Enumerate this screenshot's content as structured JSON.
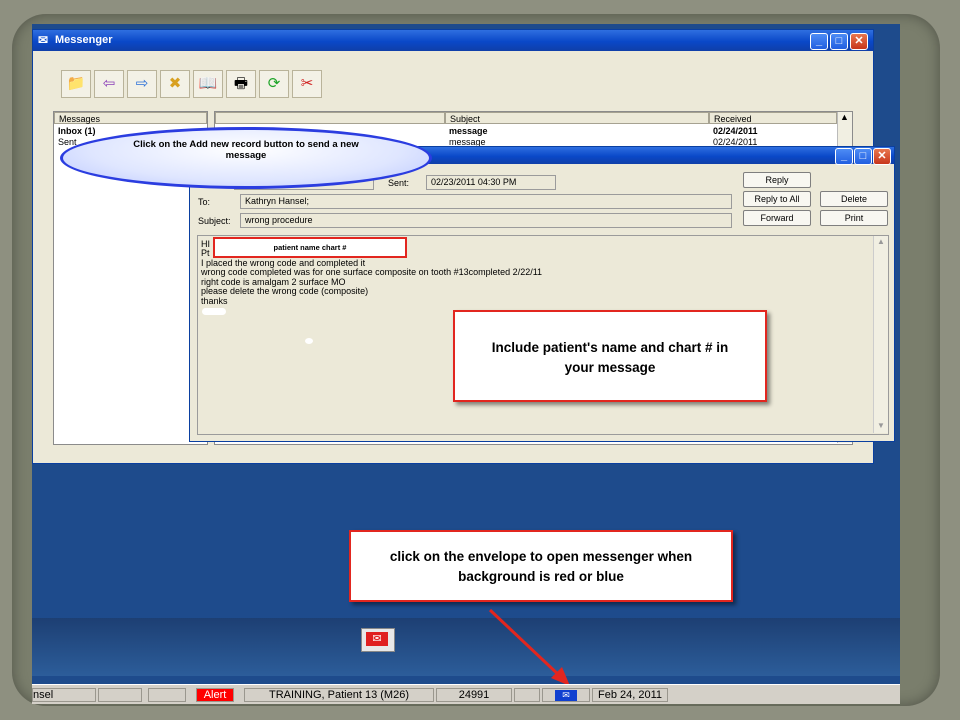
{
  "messenger": {
    "title": "Messenger",
    "toolbar_icons": [
      "add-record-icon",
      "back-icon",
      "forward-icon",
      "delete-record-icon",
      "read-icon",
      "print-icon",
      "refresh-icon",
      "close-tool-icon"
    ],
    "folders_header": "Messages",
    "folders": [
      {
        "label": "Inbox (1)"
      },
      {
        "label": "Sent"
      }
    ],
    "list_headers": {
      "subject": "Subject",
      "received": "Received"
    },
    "rows": [
      {
        "subject": "message",
        "received": "02/24/2011",
        "bold": true
      },
      {
        "subject": "message",
        "received": "02/24/2011",
        "bold": false
      }
    ]
  },
  "message": {
    "sent_label": "Sent:",
    "sent_value": "02/23/2011  04:30 PM",
    "to_label": "To:",
    "to_value": "Kathryn Hansel;",
    "subject_label": "Subject:",
    "subject_value": "wrong procedure",
    "buttons": {
      "reply": "Reply",
      "reply_all": "Reply to All",
      "delete": "Delete",
      "forward": "Forward",
      "print": "Print"
    },
    "body_lines": [
      "HI",
      "Pt",
      "I placed the wrong code and completed it",
      "wrong code completed was for one surface composite on tooth #13completed 2/22/11",
      "right code is amalgam 2 surface MO",
      "please delete the wrong code (composite)",
      "thanks"
    ]
  },
  "callouts": {
    "add_record": "Click on the Add new record button to send a new message",
    "patient_name": "patient name chart #",
    "include": "Include patient's name and chart # in your message",
    "envelope": "click on the envelope to open messenger when background is red or blue"
  },
  "status_bar": {
    "left_partial": "nsel",
    "alert": "Alert",
    "patient": "TRAINING, Patient 13 (M26)",
    "number": "24991",
    "date": "Feb 24, 2011"
  },
  "colors": {
    "alert_red": "#ff0000",
    "envelope_blue": "#1040d0",
    "callout_border": "#e2261f"
  }
}
